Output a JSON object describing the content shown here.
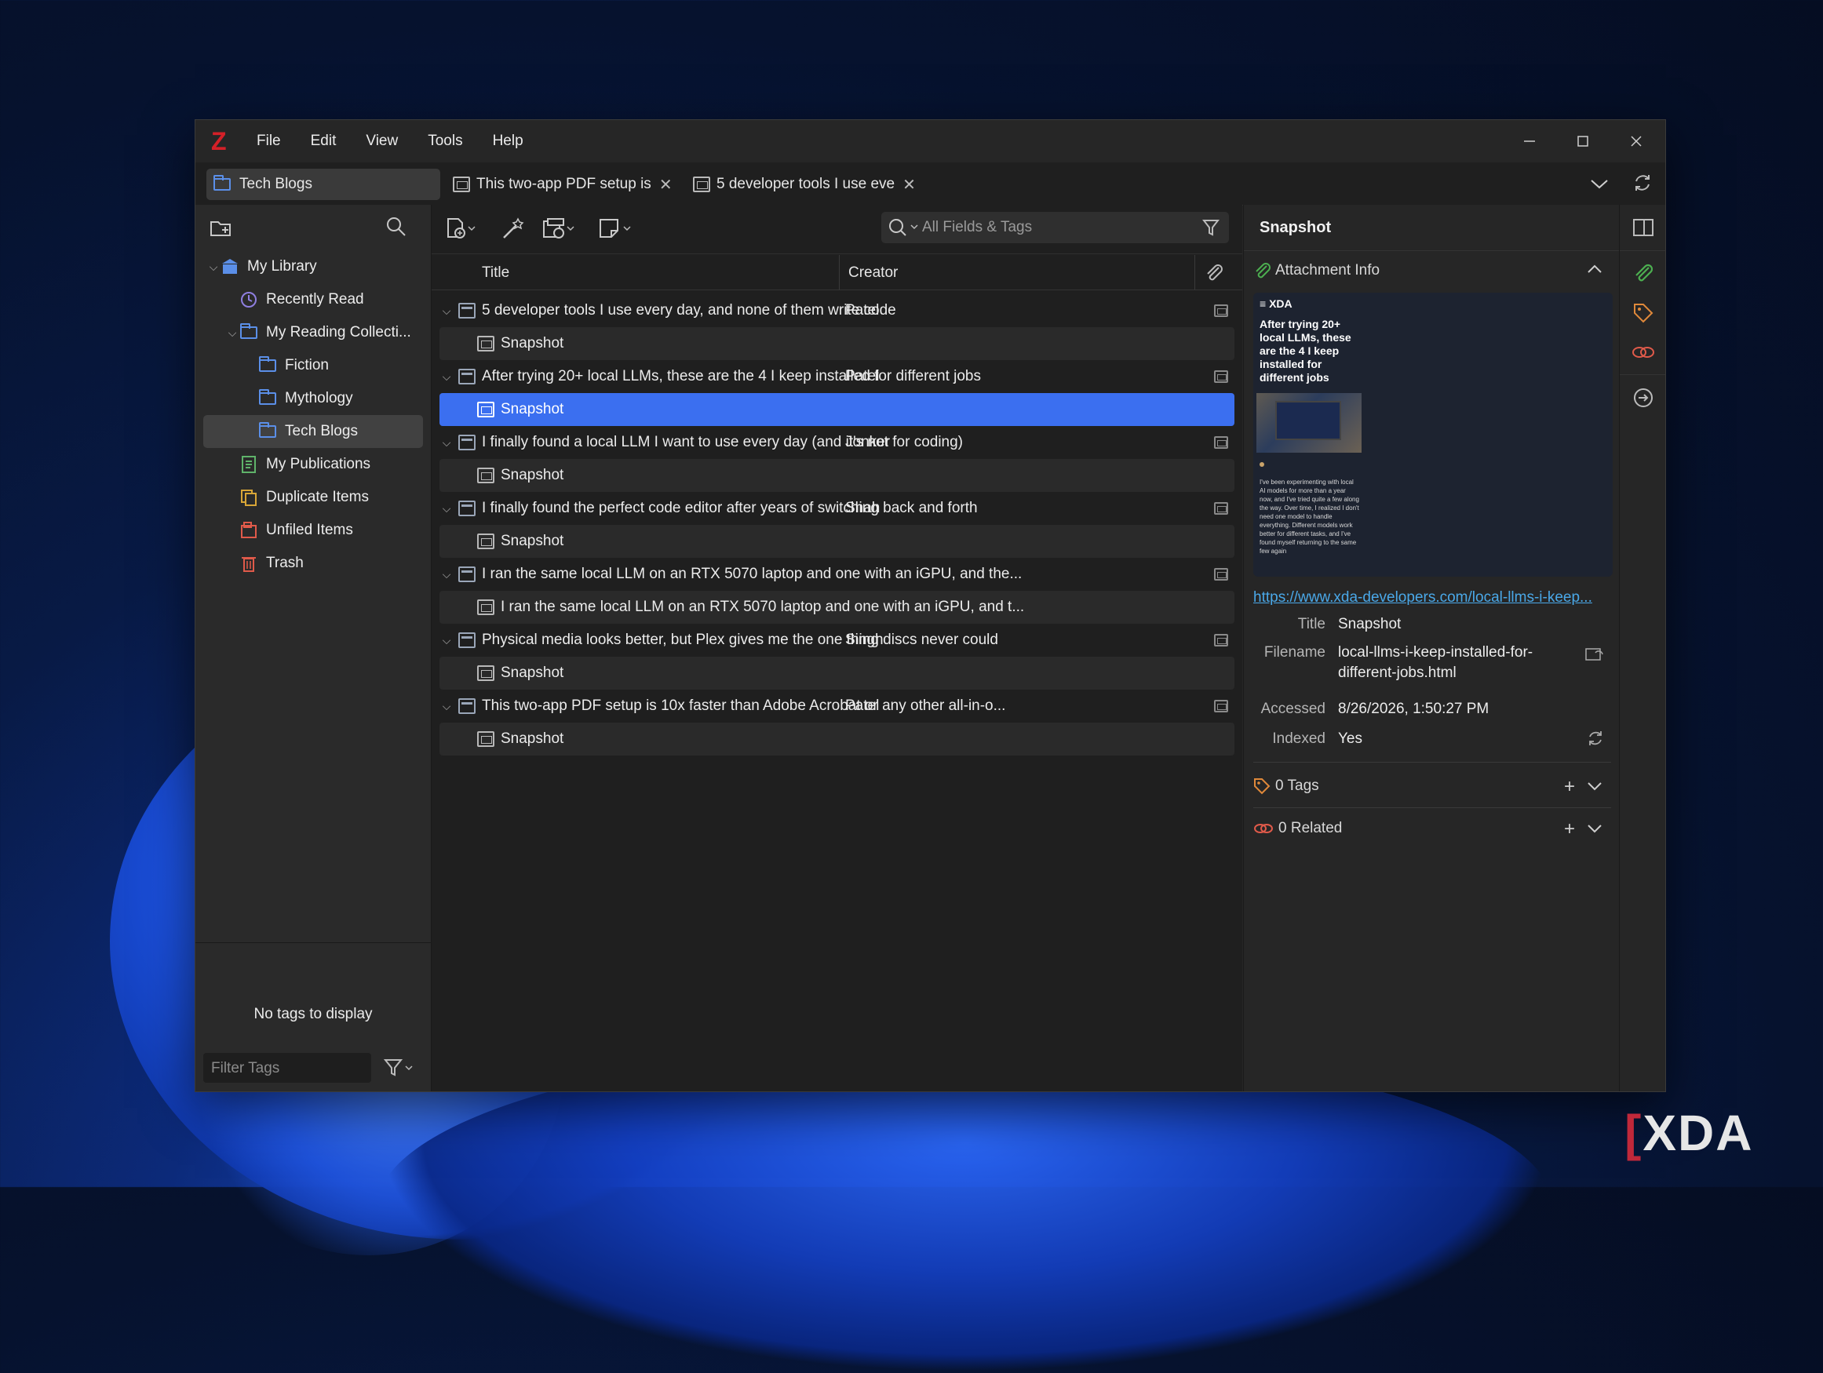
{
  "app": {
    "logo_letter": "Z"
  },
  "menu": [
    "File",
    "Edit",
    "View",
    "Tools",
    "Help"
  ],
  "tabs": [
    {
      "label": "Tech Blogs",
      "active": true
    },
    {
      "label": "This two-app PDF setup is",
      "active": false
    },
    {
      "label": "5 developer tools I use eve",
      "active": false
    }
  ],
  "collections": [
    {
      "label": "My Library",
      "icon": "library-icon",
      "level": 0
    },
    {
      "label": "Recently Read",
      "icon": "clock-icon",
      "level": 1
    },
    {
      "label": "My Reading Collecti...",
      "icon": "folder-icon",
      "level": 1
    },
    {
      "label": "Fiction",
      "icon": "folder-icon",
      "level": 2
    },
    {
      "label": "Mythology",
      "icon": "folder-icon",
      "level": 2
    },
    {
      "label": "Tech Blogs",
      "icon": "folder-icon",
      "level": 2,
      "selected": true
    },
    {
      "label": "My Publications",
      "icon": "publications-icon",
      "level": 1
    },
    {
      "label": "Duplicate Items",
      "icon": "duplicate-icon",
      "level": 1
    },
    {
      "label": "Unfiled Items",
      "icon": "unfiled-icon",
      "level": 1
    },
    {
      "label": "Trash",
      "icon": "trash-icon",
      "level": 1
    }
  ],
  "tag_selector": {
    "empty_text": "No tags to display",
    "filter_placeholder": "Filter Tags"
  },
  "search": {
    "placeholder": "All Fields & Tags"
  },
  "columns": {
    "title": "Title",
    "creator": "Creator"
  },
  "items": [
    {
      "title": "5 developer tools I use every day, and none of them write code",
      "creator": "Patel",
      "child": "Snapshot"
    },
    {
      "title": "After trying 20+ local LLMs, these are the 4 I keep installed for different jobs",
      "creator": "Patel",
      "child": "Snapshot",
      "child_selected": true
    },
    {
      "title": "I finally found a local LLM I want to use every day (and it's not for coding)",
      "creator": "Jonker",
      "child": "Snapshot"
    },
    {
      "title": "I finally found the perfect code editor after years of switching back and forth",
      "creator": "Shah",
      "child": "Snapshot"
    },
    {
      "title": "I ran the same local LLM on an RTX 5070 laptop and one with an iGPU, and the...",
      "creator": "",
      "child": "I ran the same local LLM on an RTX 5070 laptop and one with an iGPU, and t..."
    },
    {
      "title": "Physical media looks better, but Plex gives me the one thing discs never could",
      "creator": "Singh",
      "child": "Snapshot"
    },
    {
      "title": "This two-app PDF setup is 10x faster than Adobe Acrobat or any other all-in-o...",
      "creator": "Patel",
      "child": "Snapshot"
    }
  ],
  "pane": {
    "header": "Snapshot",
    "attachment_section": "Attachment Info",
    "preview": {
      "site": "XDA",
      "headline": "After trying 20+ local LLMs, these are the 4 I keep installed for different jobs",
      "body": "I've been experimenting with local AI models for more than a year now, and I've tried quite a few along the way. Over time, I realized I don't need one model to handle everything. Different models work better for different tasks, and I've found myself returning to the same few again"
    },
    "url": "https://www.xda-developers.com/local-llms-i-keep...",
    "fields": {
      "title_label": "Title",
      "title_value": "Snapshot",
      "filename_label": "Filename",
      "filename_value_1": "local-llms-i-keep-installed-for-",
      "filename_value_2": "different-jobs.html",
      "accessed_label": "Accessed",
      "accessed_value": "8/26/2026, 1:50:27 PM",
      "indexed_label": "Indexed",
      "indexed_value": "Yes"
    },
    "tags_section": "0 Tags",
    "related_section": "0 Related"
  },
  "watermark": {
    "text": "XDA"
  },
  "colors": {
    "selection": "#3b6ff0",
    "accent_green": "#4caf50",
    "accent_red": "#e05a4a"
  }
}
